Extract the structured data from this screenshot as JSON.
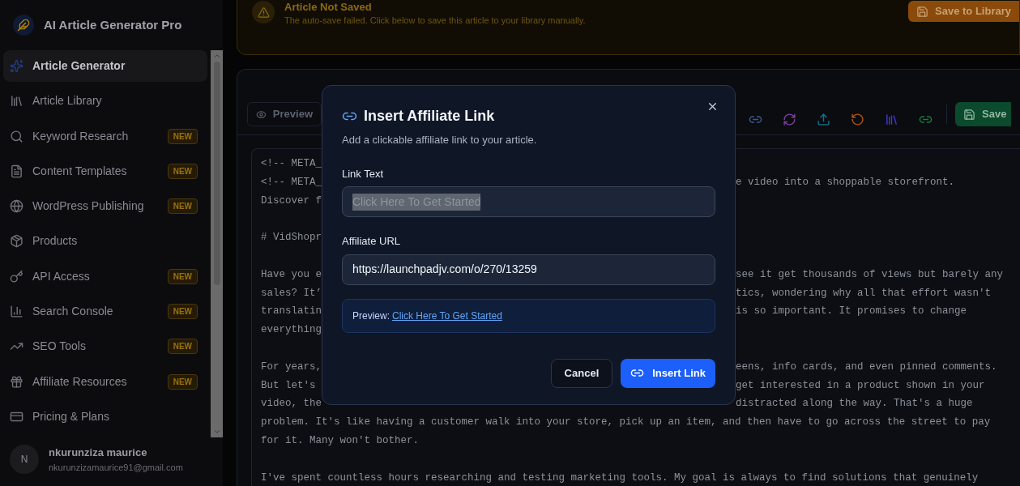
{
  "app": {
    "title": "AI Article Generator Pro"
  },
  "sidebar": {
    "items": [
      {
        "label": "Article Generator",
        "selected": true
      },
      {
        "label": "Article Library",
        "selected": false
      },
      {
        "label": "Keyword Research",
        "selected": false,
        "badge": "NEW"
      },
      {
        "label": "Content Templates",
        "selected": false,
        "badge": "NEW"
      },
      {
        "label": "WordPress Publishing",
        "selected": false,
        "badge": "NEW"
      },
      {
        "label": "Products",
        "selected": false
      },
      {
        "label": "API Access",
        "selected": false,
        "badge": "NEW"
      },
      {
        "label": "Search Console",
        "selected": false,
        "badge": "NEW"
      },
      {
        "label": "SEO Tools",
        "selected": false,
        "badge": "NEW"
      },
      {
        "label": "Affiliate Resources",
        "selected": false,
        "badge": "NEW"
      },
      {
        "label": "Pricing & Plans",
        "selected": false
      }
    ]
  },
  "user": {
    "initial": "N",
    "name": "nkurunziza maurice",
    "email": "nkurunzizamaurice91@gmail.com"
  },
  "banner": {
    "title": "Article Not Saved",
    "message": "The auto-save failed. Click below to save this article to your library manually.",
    "button": "Save to Library"
  },
  "toolbar": {
    "preview": "Preview",
    "save": "Save"
  },
  "editor": {
    "lines": [
      {
        "kind": "split",
        "left": "<!-- META_"
      },
      {
        "kind": "split",
        "left": "<!-- META_",
        "right": "e video into a shoppable storefront."
      },
      {
        "kind": "split",
        "left": "Discover f"
      },
      {
        "kind": "blank"
      },
      {
        "kind": "split",
        "left": "# VidShopr"
      },
      {
        "kind": "blank"
      },
      {
        "kind": "split",
        "left": "Have you e",
        "right": "see it get thousands of views but barely any"
      },
      {
        "kind": "split",
        "left": "sales? It’",
        "right": "tics, wondering why all that effort wasn't"
      },
      {
        "kind": "split",
        "left": "translatin",
        "right": "is so important. It promises to change"
      },
      {
        "kind": "split",
        "left": "everything"
      },
      {
        "kind": "blank"
      },
      {
        "kind": "split",
        "left": "For years,",
        "right": "eens, info cards, and even pinned comments."
      },
      {
        "kind": "split",
        "left": "But let's",
        "right": "get interested in a product shown in your"
      },
      {
        "kind": "split",
        "left": "video, the",
        "right": "distracted along the way. That's a huge"
      },
      {
        "kind": "full",
        "text": "problem. It's like having a customer walk into your store, pick up an item, and then have to go across the street to pay"
      },
      {
        "kind": "full",
        "text": "for it. Many won't bother."
      },
      {
        "kind": "blank"
      },
      {
        "kind": "full",
        "text": "I've spent countless hours researching and testing marketing tools. My goal is always to find solutions that genuinely"
      }
    ]
  },
  "dialog": {
    "title": "Insert Affiliate Link",
    "subtitle": "Add a clickable affiliate link to your article.",
    "fields": [
      {
        "label": "Link Text",
        "value": "Click Here To Get Started",
        "highlighted": true
      },
      {
        "label": "Affiliate URL",
        "value": "https://launchpadjv.com/o/270/13259",
        "highlighted": false
      }
    ],
    "preview_label": "Preview:",
    "preview_link": "Click Here To Get Started",
    "buttons": [
      {
        "label": "Cancel",
        "kind": "secondary"
      },
      {
        "label": "Insert Link",
        "kind": "primary"
      }
    ]
  }
}
